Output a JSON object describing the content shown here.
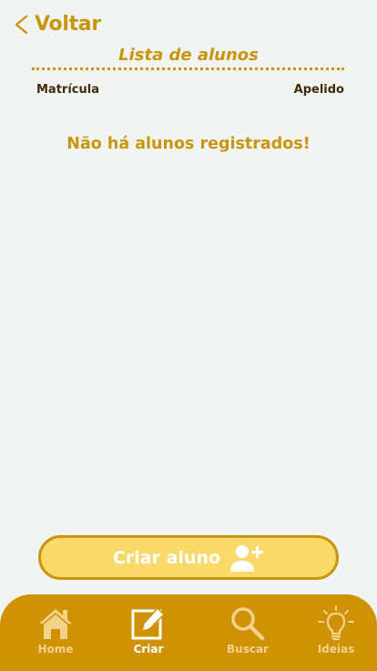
{
  "colors": {
    "accent": "#c9950a",
    "background": "#f1f4f3",
    "button_fill": "#f8d96a",
    "tabbar": "#cf9204",
    "tab_inactive": "#f3d28a",
    "tab_active": "#ffffff"
  },
  "header": {
    "back_icon": "chevron-left-icon",
    "back_label": "Voltar"
  },
  "list": {
    "title": "Lista de alunos",
    "columns": {
      "left": "Matrícula",
      "right": "Apelido"
    },
    "empty_message": "Não há alunos registrados!"
  },
  "create_button": {
    "label": "Criar aluno",
    "icon": "add-user-icon"
  },
  "tabbar": {
    "tabs": [
      {
        "label": "Home",
        "icon": "home-icon",
        "active": false
      },
      {
        "label": "Criar",
        "icon": "edit-icon",
        "active": true
      },
      {
        "label": "Buscar",
        "icon": "search-icon",
        "active": false
      },
      {
        "label": "Ideias",
        "icon": "lightbulb-icon",
        "active": false
      }
    ]
  }
}
